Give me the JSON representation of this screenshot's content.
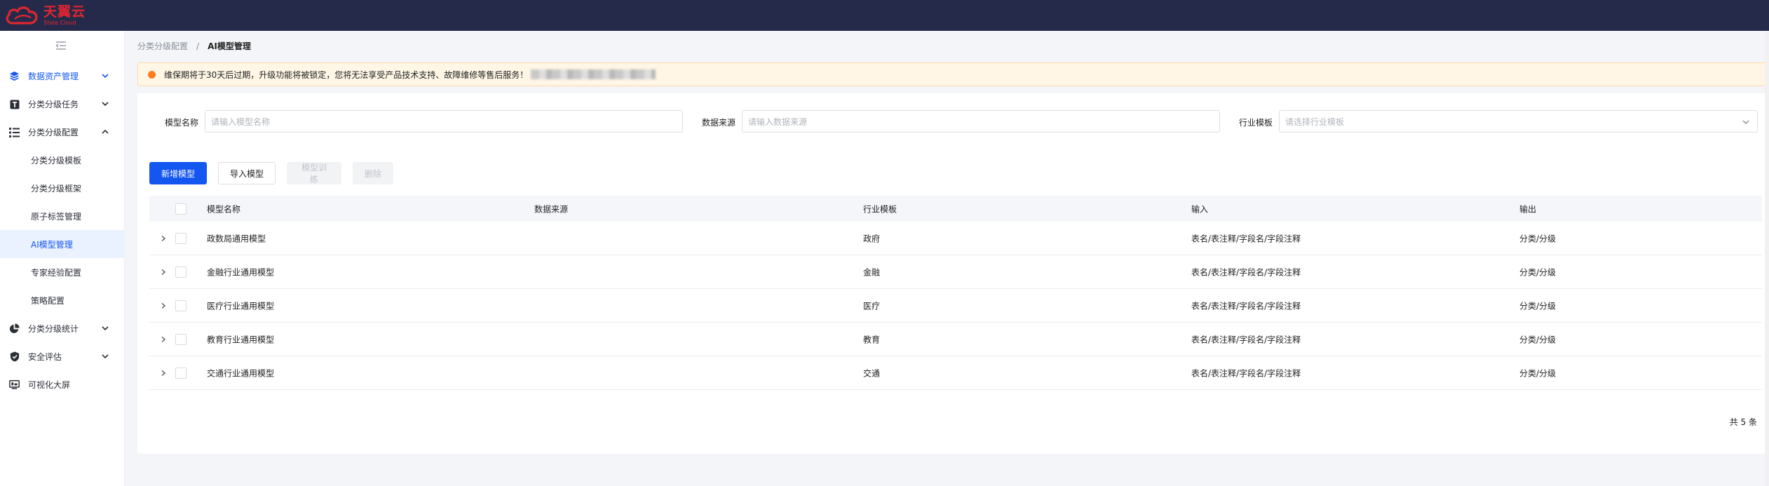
{
  "brand": {
    "name_cn": "天翼云",
    "name_en": "State Cloud",
    "color": "#e0262f"
  },
  "sidebar": {
    "items": [
      {
        "label": "数据资产管理",
        "icon": "layers-icon",
        "expandable": true,
        "active": true
      },
      {
        "label": "分类分级任务",
        "icon": "task-icon",
        "expandable": true
      },
      {
        "label": "分类分级配置",
        "icon": "list-icon",
        "expandable": true,
        "open": true,
        "children": [
          {
            "label": "分类分级模板"
          },
          {
            "label": "分类分级框架"
          },
          {
            "label": "原子标签管理"
          },
          {
            "label": "AI模型管理",
            "selected": true
          },
          {
            "label": "专家经验配置"
          },
          {
            "label": "策略配置"
          }
        ]
      },
      {
        "label": "分类分级统计",
        "icon": "pie-chart-icon",
        "expandable": true
      },
      {
        "label": "安全评估",
        "icon": "shield-icon",
        "expandable": true
      },
      {
        "label": "可视化大屏",
        "icon": "screen-icon",
        "expandable": false
      }
    ]
  },
  "breadcrumb": {
    "parent": "分类分级配置",
    "separator": "/",
    "current": "AI模型管理"
  },
  "notice": {
    "text": "维保期将于30天后过期，升级功能将被锁定，您将无法享受产品技术支持、故障维修等售后服务！"
  },
  "filters": {
    "model_name": {
      "label": "模型名称",
      "placeholder": "请输入模型名称"
    },
    "data_source": {
      "label": "数据来源",
      "placeholder": "请输入数据来源"
    },
    "industry_template": {
      "label": "行业模板",
      "placeholder": "请选择行业模板"
    }
  },
  "actions": {
    "add": "新增模型",
    "import": "导入模型",
    "train": "模型训练",
    "delete": "删除"
  },
  "table": {
    "columns": [
      "模型名称",
      "数据来源",
      "行业模板",
      "输入",
      "输出"
    ],
    "rows": [
      {
        "name": "政数局通用模型",
        "source": "",
        "industry": "政府",
        "input": "表名/表注释/字段名/字段注释",
        "output": "分类/分级"
      },
      {
        "name": "金融行业通用模型",
        "source": "",
        "industry": "金融",
        "input": "表名/表注释/字段名/字段注释",
        "output": "分类/分级"
      },
      {
        "name": "医疗行业通用模型",
        "source": "",
        "industry": "医疗",
        "input": "表名/表注释/字段名/字段注释",
        "output": "分类/分级"
      },
      {
        "name": "教育行业通用模型",
        "source": "",
        "industry": "教育",
        "input": "表名/表注释/字段名/字段注释",
        "output": "分类/分级"
      },
      {
        "name": "交通行业通用模型",
        "source": "",
        "industry": "交通",
        "input": "表名/表注释/字段名/字段注释",
        "output": "分类/分级"
      }
    ]
  },
  "pagination": {
    "total_text": "共 5 条"
  },
  "colors": {
    "primary": "#1456f0",
    "topbar": "#262a4a",
    "notice_bg": "#fff6e6",
    "notice_dot": "#ff7d1a"
  }
}
